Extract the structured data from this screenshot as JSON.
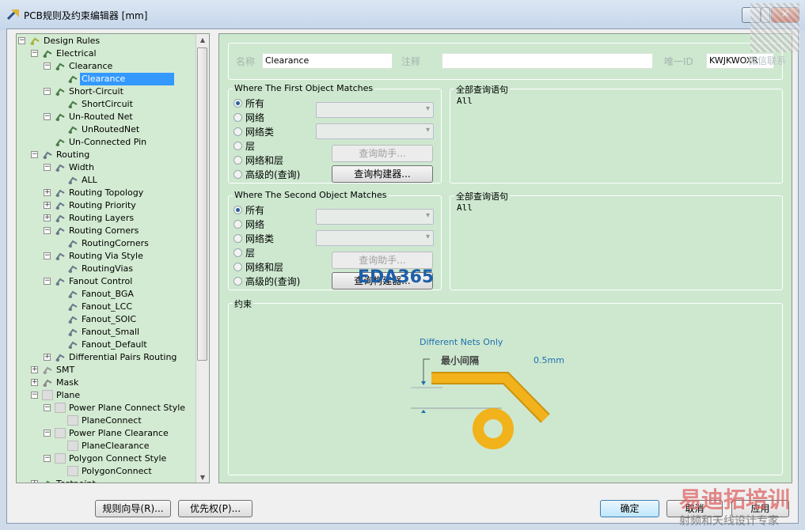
{
  "window": {
    "title": "PCB规则及约束编辑器 [mm]",
    "close": "✕"
  },
  "tree": {
    "items": [
      {
        "label": "Design Rules",
        "level": 0,
        "exp": "-",
        "icon": "design-rules"
      },
      {
        "label": "Electrical",
        "level": 1,
        "exp": "-",
        "icon": "electrical"
      },
      {
        "label": "Clearance",
        "level": 2,
        "exp": "-",
        "icon": "electrical"
      },
      {
        "label": "Clearance",
        "level": 3,
        "exp": "",
        "icon": "electrical",
        "selected": true
      },
      {
        "label": "Short-Circuit",
        "level": 2,
        "exp": "-",
        "icon": "electrical"
      },
      {
        "label": "ShortCircuit",
        "level": 3,
        "exp": "",
        "icon": "electrical"
      },
      {
        "label": "Un-Routed Net",
        "level": 2,
        "exp": "-",
        "icon": "electrical"
      },
      {
        "label": "UnRoutedNet",
        "level": 3,
        "exp": "",
        "icon": "electrical"
      },
      {
        "label": "Un-Connected Pin",
        "level": 2,
        "exp": "",
        "icon": "electrical"
      },
      {
        "label": "Routing",
        "level": 1,
        "exp": "-",
        "icon": "routing"
      },
      {
        "label": "Width",
        "level": 2,
        "exp": "-",
        "icon": "routing"
      },
      {
        "label": "ALL",
        "level": 3,
        "exp": "",
        "icon": "routing"
      },
      {
        "label": "Routing Topology",
        "level": 2,
        "exp": "+",
        "icon": "routing"
      },
      {
        "label": "Routing Priority",
        "level": 2,
        "exp": "+",
        "icon": "routing"
      },
      {
        "label": "Routing Layers",
        "level": 2,
        "exp": "+",
        "icon": "routing"
      },
      {
        "label": "Routing Corners",
        "level": 2,
        "exp": "-",
        "icon": "routing"
      },
      {
        "label": "RoutingCorners",
        "level": 3,
        "exp": "",
        "icon": "routing"
      },
      {
        "label": "Routing Via Style",
        "level": 2,
        "exp": "-",
        "icon": "routing"
      },
      {
        "label": "RoutingVias",
        "level": 3,
        "exp": "",
        "icon": "routing"
      },
      {
        "label": "Fanout Control",
        "level": 2,
        "exp": "-",
        "icon": "routing"
      },
      {
        "label": "Fanout_BGA",
        "level": 3,
        "exp": "",
        "icon": "routing"
      },
      {
        "label": "Fanout_LCC",
        "level": 3,
        "exp": "",
        "icon": "routing"
      },
      {
        "label": "Fanout_SOIC",
        "level": 3,
        "exp": "",
        "icon": "routing"
      },
      {
        "label": "Fanout_Small",
        "level": 3,
        "exp": "",
        "icon": "routing"
      },
      {
        "label": "Fanout_Default",
        "level": 3,
        "exp": "",
        "icon": "routing"
      },
      {
        "label": "Differential Pairs Routing",
        "level": 2,
        "exp": "+",
        "icon": "routing"
      },
      {
        "label": "SMT",
        "level": 1,
        "exp": "+",
        "icon": "smt"
      },
      {
        "label": "Mask",
        "level": 1,
        "exp": "+",
        "icon": "mask"
      },
      {
        "label": "Plane",
        "level": 1,
        "exp": "-",
        "icon": "plane"
      },
      {
        "label": "Power Plane Connect Style",
        "level": 2,
        "exp": "-",
        "icon": "plane"
      },
      {
        "label": "PlaneConnect",
        "level": 3,
        "exp": "",
        "icon": "plane"
      },
      {
        "label": "Power Plane Clearance",
        "level": 2,
        "exp": "-",
        "icon": "plane"
      },
      {
        "label": "PlaneClearance",
        "level": 3,
        "exp": "",
        "icon": "plane"
      },
      {
        "label": "Polygon Connect Style",
        "level": 2,
        "exp": "-",
        "icon": "plane"
      },
      {
        "label": "PolygonConnect",
        "level": 3,
        "exp": "",
        "icon": "plane"
      },
      {
        "label": "Testpoint",
        "level": 1,
        "exp": "+",
        "icon": "testpoint"
      }
    ]
  },
  "header": {
    "name_label": "名称",
    "name_value": "Clearance",
    "comment_label": "注释",
    "comment_value": "",
    "uid_label": "唯一ID",
    "uid_value": "KWJKWOXR"
  },
  "first": {
    "title": "Where The First Object Matches",
    "options": [
      "所有",
      "网络",
      "网络类",
      "层",
      "网络和层",
      "高级的(查询)"
    ],
    "selected": 0,
    "helper": "查询助手...",
    "builder": "查询构建器...",
    "query_title": "全部查询语句",
    "query": "All"
  },
  "second": {
    "title": "Where The Second Object Matches",
    "options": [
      "所有",
      "网络",
      "网络类",
      "层",
      "网络和层",
      "高级的(查询)"
    ],
    "selected": 0,
    "helper": "查询助手...",
    "builder": "查询构建器...",
    "query_title": "全部查询语句",
    "query": "All"
  },
  "constraint": {
    "title": "约束",
    "mode": "Different Nets Only",
    "min_label": "最小间隔",
    "value": "0.5mm",
    "colors": {
      "copper": "#f2b21b",
      "dim": "#1f6fb0"
    }
  },
  "footer": {
    "wizard": "规则向导(R)...",
    "priority": "优先权(P)...",
    "ok": "确定",
    "cancel": "取消",
    "apply": "应用"
  },
  "watermarks": {
    "eda": "EDA365",
    "wechat": "微信联系",
    "brand": "易迪拓培训",
    "slogan": "射频和天线设计专家"
  }
}
